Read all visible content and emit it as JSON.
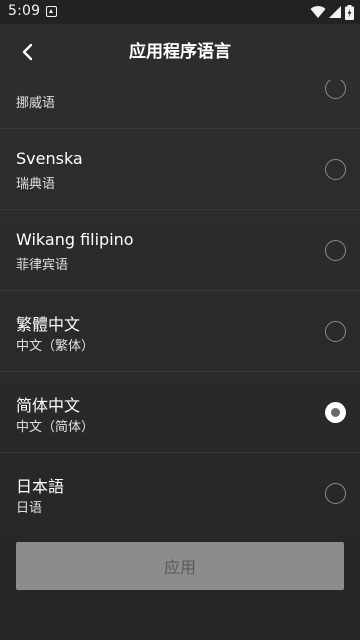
{
  "status_bar": {
    "time": "5:09",
    "icons": [
      "notification-icon",
      "wifi-icon",
      "cellular-icon",
      "battery-charging-icon"
    ]
  },
  "toolbar": {
    "title": "应用程序语言",
    "back_icon": "back-arrow-icon"
  },
  "languages": [
    {
      "name": "",
      "native_label": "挪威语",
      "selected": false
    },
    {
      "name": "Svenska",
      "native_label": "瑞典语",
      "selected": false
    },
    {
      "name": "Wikang filipino",
      "native_label": "菲律宾语",
      "selected": false
    },
    {
      "name": "繁體中文",
      "native_label": "中文（繁体）",
      "selected": false
    },
    {
      "name": "简体中文",
      "native_label": "中文（简体）",
      "selected": true
    },
    {
      "name": "日本語",
      "native_label": "日语",
      "selected": false
    }
  ],
  "apply_button": {
    "label": "应用",
    "enabled": false
  },
  "colors": {
    "background": "#2b2b2b",
    "divider": "#3a3a3a",
    "button_disabled": "#8c8c8c",
    "button_text_disabled": "#5a5a5a"
  }
}
